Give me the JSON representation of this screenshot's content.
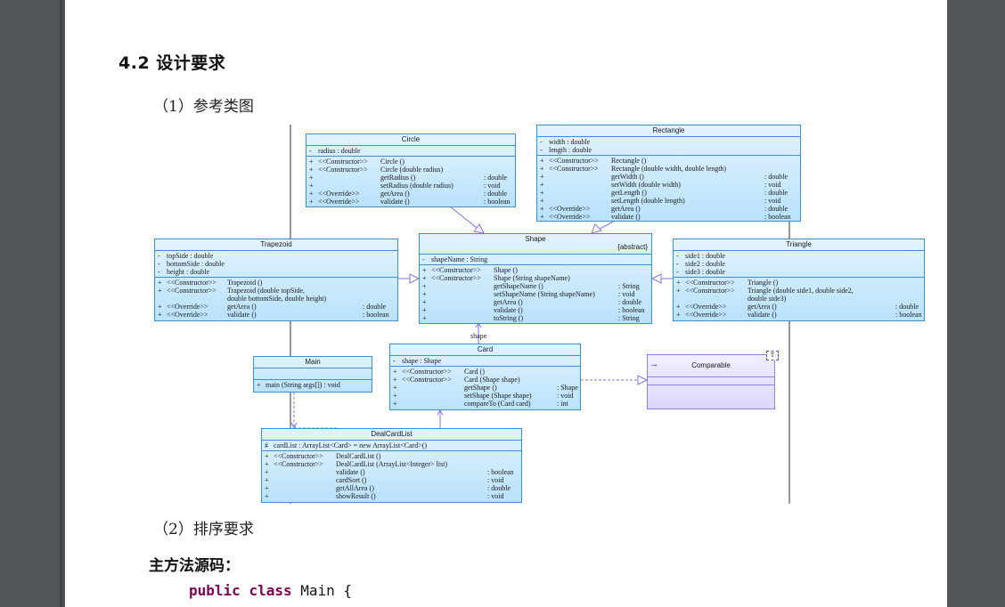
{
  "heading": "4.2 设计要求",
  "sub1": "（1）参考类图",
  "sub2": "（2）排序要求",
  "source_heading": "主方法源码：",
  "code": {
    "kw1": "public",
    "kw2": "class",
    "rest": " Main {"
  },
  "assoc_label": "shape",
  "circle": {
    "name": "Circle",
    "attrs": [
      {
        "v": "-",
        "n": "radius : double"
      }
    ],
    "ops": [
      {
        "v": "+",
        "s": "<<Constructor>>",
        "n": "Circle ()",
        "t": ""
      },
      {
        "v": "+",
        "s": "<<Constructor>>",
        "n": "Circle (double radius)",
        "t": ""
      },
      {
        "v": "+",
        "s": "",
        "n": "getRadius ()",
        "t": ": double"
      },
      {
        "v": "+",
        "s": "",
        "n": "setRadius (double radius)",
        "t": ": void"
      },
      {
        "v": "+",
        "s": "<<Override>>",
        "n": "getArea ()",
        "t": ": double"
      },
      {
        "v": "+",
        "s": "<<Override>>",
        "n": "validate ()",
        "t": ": boolean"
      }
    ]
  },
  "rectangle": {
    "name": "Rectangle",
    "attrs": [
      {
        "v": "-",
        "n": "width   : double"
      },
      {
        "v": "-",
        "n": "length  : double"
      }
    ],
    "ops": [
      {
        "v": "+",
        "s": "<<Constructor>>",
        "n": "Rectangle ()",
        "t": ""
      },
      {
        "v": "+",
        "s": "<<Constructor>>",
        "n": "Rectangle (double width,  double length)",
        "t": ""
      },
      {
        "v": "+",
        "s": "",
        "n": "getWidth ()",
        "t": ": double"
      },
      {
        "v": "+",
        "s": "",
        "n": "setWidth (double width)",
        "t": ": void"
      },
      {
        "v": "+",
        "s": "",
        "n": "getLength ()",
        "t": ": double"
      },
      {
        "v": "+",
        "s": "",
        "n": "setLength (double length)",
        "t": ": void"
      },
      {
        "v": "+",
        "s": "<<Override>>",
        "n": "getArea ()",
        "t": ": double"
      },
      {
        "v": "+",
        "s": "<<Override>>",
        "n": "validate ()",
        "t": ": boolean"
      }
    ]
  },
  "trapezoid": {
    "name": "Trapezoid",
    "attrs": [
      {
        "v": "-",
        "n": "topSide      : double"
      },
      {
        "v": "-",
        "n": "bottomSide : double"
      },
      {
        "v": "-",
        "n": "height        : double"
      }
    ],
    "ops": [
      {
        "v": "+",
        "s": "<<Constructor>>",
        "n": "Trapezoid ()",
        "t": ""
      },
      {
        "v": "+",
        "s": "<<Constructor>>",
        "n": "Trapezoid (double topSide,",
        "t": ""
      },
      {
        "v": "",
        "s": "",
        "n": "     double bottomSide,  double height)",
        "t": ""
      },
      {
        "v": "+",
        "s": "<<Override>>",
        "n": "getArea ()",
        "t": ": double"
      },
      {
        "v": "+",
        "s": "<<Override>>",
        "n": "validate ()",
        "t": ": boolean"
      }
    ]
  },
  "shape": {
    "name": "Shape",
    "stereo": "{abstract}",
    "attrs": [
      {
        "v": "-",
        "n": "shapeName : String"
      }
    ],
    "ops": [
      {
        "v": "+",
        "s": "<<Constructor>>",
        "n": "Shape ()",
        "t": ""
      },
      {
        "v": "+",
        "s": "<<Constructor>>",
        "n": "Shape (String shapeName)",
        "t": ""
      },
      {
        "v": "+",
        "s": "",
        "n": "getShapeName ()",
        "t": ": String"
      },
      {
        "v": "+",
        "s": "",
        "n": "setShapeName (String shapeName)",
        "t": ": void"
      },
      {
        "v": "+",
        "s": "",
        "n": "getArea ()",
        "t": ": double"
      },
      {
        "v": "+",
        "s": "",
        "n": "validate ()",
        "t": ": boolean"
      },
      {
        "v": "+",
        "s": "",
        "n": "toString ()",
        "t": ": String"
      }
    ]
  },
  "triangle": {
    "name": "Triangle",
    "attrs": [
      {
        "v": "-",
        "n": "side1  : double"
      },
      {
        "v": "-",
        "n": "side2  : double"
      },
      {
        "v": "-",
        "n": "side3  : double"
      }
    ],
    "ops": [
      {
        "v": "+",
        "s": "<<Constructor>>",
        "n": "Triangle ()",
        "t": ""
      },
      {
        "v": "+",
        "s": "<<Constructor>>",
        "n": "Triangle (double side1,  double side2,",
        "t": ""
      },
      {
        "v": "",
        "s": "",
        "n": "     double side3)",
        "t": ""
      },
      {
        "v": "+",
        "s": "<<Override>>",
        "n": "getArea ()",
        "t": ": double"
      },
      {
        "v": "+",
        "s": "<<Override>>",
        "n": "validate ()",
        "t": ": boolean"
      }
    ]
  },
  "main": {
    "name": "Main",
    "ops": [
      {
        "v": "+",
        "s": "",
        "n": "main (String args[]) : void",
        "t": ""
      }
    ]
  },
  "card": {
    "name": "Card",
    "attrs": [
      {
        "v": "-",
        "n": "shape : Shape"
      }
    ],
    "ops": [
      {
        "v": "+",
        "s": "<<Constructor>>",
        "n": "Card ()",
        "t": ""
      },
      {
        "v": "+",
        "s": "<<Constructor>>",
        "n": "Card (Shape shape)",
        "t": ""
      },
      {
        "v": "+",
        "s": "",
        "n": "getShape ()",
        "t": ": Shape"
      },
      {
        "v": "+",
        "s": "",
        "n": "setShape (Shape shape)",
        "t": ": void"
      },
      {
        "v": "+",
        "s": "",
        "n": "compareTo (Card card)",
        "t": ": int"
      }
    ]
  },
  "comparable": {
    "name": "Comparable",
    "param": "T"
  },
  "dealcardlist": {
    "name": "DealCardList",
    "attrs": [
      {
        "v": "#",
        "n": "cardList : ArrayList<Card> = new ArrayList<Card>()"
      }
    ],
    "ops": [
      {
        "v": "+",
        "s": "<<Constructor>>",
        "n": "DealCardList ()",
        "t": ""
      },
      {
        "v": "+",
        "s": "<<Constructor>>",
        "n": "DealCardList (ArrayList<Integer> list)",
        "t": ""
      },
      {
        "v": "+",
        "s": "",
        "n": "validate ()",
        "t": ": boolean"
      },
      {
        "v": "+",
        "s": "",
        "n": "cardSort ()",
        "t": ": void"
      },
      {
        "v": "+",
        "s": "",
        "n": "getAllArea ()",
        "t": ": double"
      },
      {
        "v": "+",
        "s": "",
        "n": "showResult ()",
        "t": ": void"
      }
    ]
  }
}
